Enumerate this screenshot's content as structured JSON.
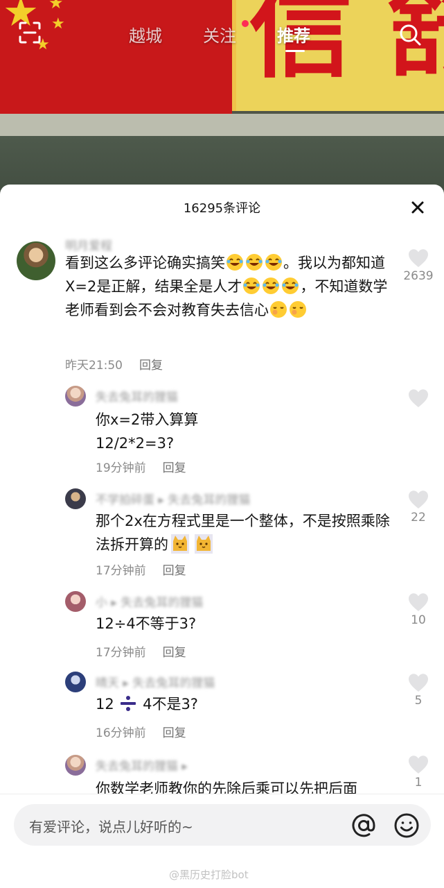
{
  "topnav": {
    "tabs": [
      "越城",
      "关注",
      "推荐"
    ],
    "active_tab": "推荐",
    "icons": {
      "scan": "scan-icon",
      "search": "search-icon"
    },
    "notification_color": "#fe2c55"
  },
  "background": {
    "banner_text": "信舒"
  },
  "comments_panel": {
    "count_label": "16295条评论",
    "close_icon": "close-icon"
  },
  "comments": [
    {
      "username": "明月爱程",
      "segments": [
        "看到这么多评论确实搞笑",
        "。我以为都知道X=2是正解，结果全是人才",
        "，不知道数学老师看到会不会对教育失去信心"
      ],
      "emojis": [
        "rolling-laugh-emoji",
        "tears-of-joy-emoji",
        "smirk-emoji"
      ],
      "time": "昨天21:50",
      "reply_label": "回复",
      "likes": "2639"
    },
    {
      "username": "失去兔耳的狸猫",
      "text": "你x=2带入算算\n12/2*2=3?",
      "time": "19分钟前",
      "reply_label": "回复",
      "likes": ""
    },
    {
      "username": "不学拍碎蛋 ▸ 失去兔耳的狸猫",
      "segments": [
        "那个2x在方程式里是一个整体，不是按照乘除法拆开算的"
      ],
      "emojis": [
        "cat-emoji"
      ],
      "time": "17分钟前",
      "reply_label": "回复",
      "likes": "22"
    },
    {
      "username": "小 ▸ 失去兔耳的狸猫",
      "text": "12÷4不等于3?",
      "time": "17分钟前",
      "reply_label": "回复",
      "likes": "10"
    },
    {
      "username": "晴天 ▸ 失去兔耳的狸猫",
      "segments": [
        "12 ",
        " 4不是3?"
      ],
      "time": "16分钟前",
      "reply_label": "回复",
      "likes": "5"
    },
    {
      "username": "失去兔耳的狸猫 ▸",
      "text": "你数学老师教你的先除后乘可以先把后面",
      "likes": "1"
    }
  ],
  "input": {
    "placeholder": "有爱评论，说点儿好听的~",
    "icons": {
      "mention": "at-icon",
      "emoji": "smile-icon"
    }
  },
  "watermark": "@黑历史打脸bot"
}
